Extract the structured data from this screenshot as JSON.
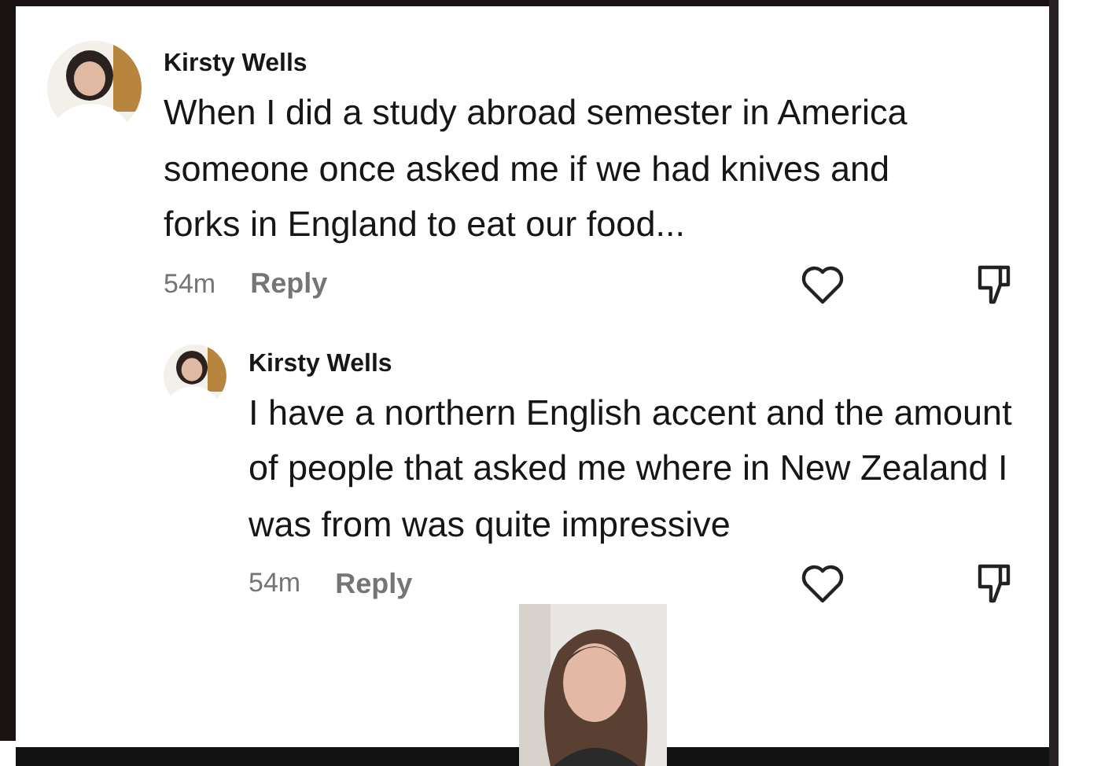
{
  "comments": [
    {
      "author": "Kirsty Wells",
      "text": "When I did a study abroad semester in America someone once asked me if we had knives and forks in England to eat our food...",
      "time": "54m",
      "reply_label": "Reply",
      "kind": "comment"
    },
    {
      "author": "Kirsty Wells",
      "text": "I have a northern English accent and the amount of people that asked me where in New Zealand I was from was quite impressive",
      "time": "54m",
      "reply_label": "Reply",
      "kind": "reply"
    }
  ]
}
